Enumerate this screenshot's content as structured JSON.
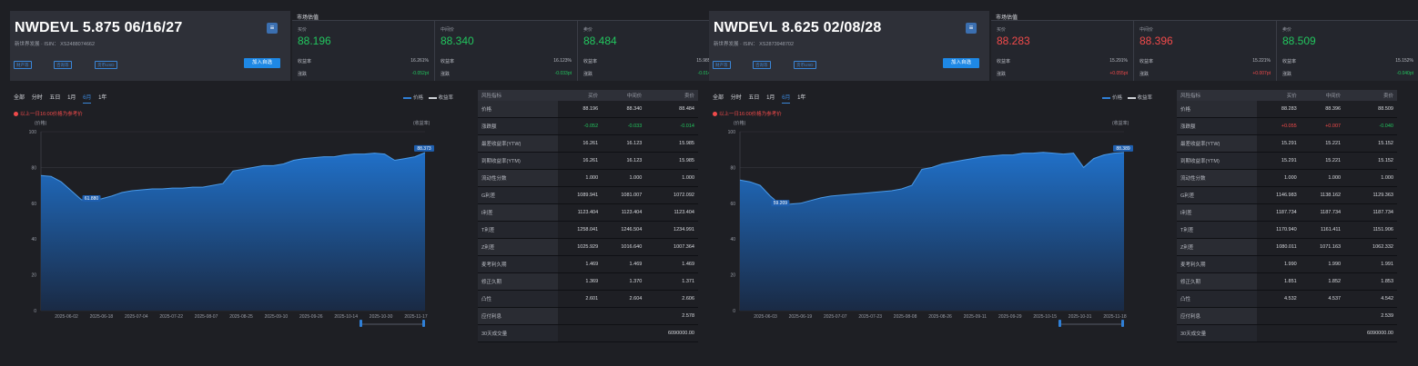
{
  "panels": [
    {
      "title": "NWDEVL 5.875 06/16/27",
      "subtitle": "新世界发展 · ISIN： XS2488074662",
      "tags": [
        "财产等",
        "咨询等",
        "货币USD"
      ],
      "add_button": "加入自选",
      "market": {
        "title": "市场估值",
        "quotes": [
          {
            "label": "买价",
            "price": "88.196",
            "yield_label": "收益率",
            "yield": "16.261%",
            "chg_label": "涨跌",
            "chg": "-0.052pt",
            "price_color": "green",
            "chg_color": "green"
          },
          {
            "label": "中间价",
            "price": "88.340",
            "yield_label": "收益率",
            "yield": "16.123%",
            "chg_label": "涨跌",
            "chg": "-0.033pt",
            "price_color": "green",
            "chg_color": "green"
          },
          {
            "label": "卖价",
            "price": "88.484",
            "yield_label": "收益率",
            "yield": "15.985%",
            "chg_label": "涨跌",
            "chg": "-0.014pt",
            "price_color": "green",
            "chg_color": "green"
          }
        ]
      },
      "chart": {
        "tabs": [
          "全部",
          "分时",
          "五日",
          "1月",
          "6月",
          "1年"
        ],
        "active_tab": "6月",
        "legend": [
          "价格",
          "收益率"
        ],
        "notice": "以上一日16:00价格为参考价",
        "ylabel_left": "(价格)",
        "ylabel_right": "(收益率)"
      },
      "risk_table": {
        "headers": [
          "风险指标",
          "买价",
          "中间价",
          "卖价"
        ],
        "rows": [
          {
            "label": "价格",
            "bid": "88.196",
            "mid": "88.340",
            "ask": "88.484"
          },
          {
            "label": "涨跌额",
            "bid": "-0.052",
            "mid": "-0.033",
            "ask": "-0.014",
            "color": "green"
          },
          {
            "label": "最差收益率(YTW)",
            "bid": "16.261",
            "mid": "16.123",
            "ask": "15.985"
          },
          {
            "label": "到期收益率(YTM)",
            "bid": "16.261",
            "mid": "16.123",
            "ask": "15.985"
          },
          {
            "label": "流动性分数",
            "bid": "1.000",
            "mid": "1.000",
            "ask": "1.000"
          },
          {
            "label": "G利差",
            "bid": "1089.941",
            "mid": "1081.007",
            "ask": "1072.092"
          },
          {
            "label": "I利差",
            "bid": "1123.404",
            "mid": "1123.404",
            "ask": "1123.404"
          },
          {
            "label": "T利差",
            "bid": "1258.041",
            "mid": "1246.504",
            "ask": "1234.991"
          },
          {
            "label": "Z利差",
            "bid": "1025.929",
            "mid": "1016.640",
            "ask": "1007.364"
          },
          {
            "label": "麦考利久期",
            "bid": "1.469",
            "mid": "1.469",
            "ask": "1.469"
          },
          {
            "label": "修正久期",
            "bid": "1.369",
            "mid": "1.370",
            "ask": "1.371"
          },
          {
            "label": "凸性",
            "bid": "2.601",
            "mid": "2.604",
            "ask": "2.606"
          },
          {
            "label": "应付利息",
            "bid": "",
            "mid": "",
            "ask": "2.578"
          },
          {
            "label": "30天成交量",
            "bid": "",
            "mid": "",
            "ask": "6090000.00"
          }
        ]
      }
    },
    {
      "title": "NWDEVL 8.625 02/08/28",
      "subtitle": "新世界发展 · ISIN： XS2873948702",
      "tags": [
        "财产等",
        "咨询等",
        "货币USD"
      ],
      "add_button": "加入自选",
      "market": {
        "title": "市场估值",
        "quotes": [
          {
            "label": "买价",
            "price": "88.283",
            "yield_label": "收益率",
            "yield": "15.291%",
            "chg_label": "涨跌",
            "chg": "+0.055pt",
            "price_color": "red",
            "chg_color": "red"
          },
          {
            "label": "中间价",
            "price": "88.396",
            "yield_label": "收益率",
            "yield": "15.221%",
            "chg_label": "涨跌",
            "chg": "+0.007pt",
            "price_color": "red",
            "chg_color": "red"
          },
          {
            "label": "卖价",
            "price": "88.509",
            "yield_label": "收益率",
            "yield": "15.152%",
            "chg_label": "涨跌",
            "chg": "-0.040pt",
            "price_color": "green",
            "chg_color": "green"
          }
        ]
      },
      "chart": {
        "tabs": [
          "全部",
          "分时",
          "五日",
          "1月",
          "6月",
          "1年"
        ],
        "active_tab": "6月",
        "legend": [
          "价格",
          "收益率"
        ],
        "notice": "以上一日16:00价格为参考价",
        "ylabel_left": "(价格)",
        "ylabel_right": "(收益率)"
      },
      "risk_table": {
        "headers": [
          "风险指标",
          "买价",
          "中间价",
          "卖价"
        ],
        "rows": [
          {
            "label": "价格",
            "bid": "88.283",
            "mid": "88.396",
            "ask": "88.509"
          },
          {
            "label": "涨跌额",
            "bid": "+0.055",
            "mid": "+0.007",
            "ask": "-0.040",
            "color": "mixed"
          },
          {
            "label": "最差收益率(YTW)",
            "bid": "15.291",
            "mid": "15.221",
            "ask": "15.152"
          },
          {
            "label": "到期收益率(YTM)",
            "bid": "15.291",
            "mid": "15.221",
            "ask": "15.152"
          },
          {
            "label": "流动性分数",
            "bid": "1.000",
            "mid": "1.000",
            "ask": "1.000"
          },
          {
            "label": "G利差",
            "bid": "1146.983",
            "mid": "1138.162",
            "ask": "1129.363"
          },
          {
            "label": "I利差",
            "bid": "1187.734",
            "mid": "1187.734",
            "ask": "1187.734"
          },
          {
            "label": "T利差",
            "bid": "1170.940",
            "mid": "1161.411",
            "ask": "1151.906"
          },
          {
            "label": "Z利差",
            "bid": "1080.011",
            "mid": "1071.163",
            "ask": "1062.332"
          },
          {
            "label": "麦考利久期",
            "bid": "1.990",
            "mid": "1.990",
            "ask": "1.991"
          },
          {
            "label": "修正久期",
            "bid": "1.851",
            "mid": "1.852",
            "ask": "1.853"
          },
          {
            "label": "凸性",
            "bid": "4.532",
            "mid": "4.537",
            "ask": "4.542"
          },
          {
            "label": "应付利息",
            "bid": "",
            "mid": "",
            "ask": "2.539"
          },
          {
            "label": "30天成交量",
            "bid": "",
            "mid": "",
            "ask": "6090000.00"
          }
        ]
      }
    }
  ],
  "chart_data": [
    {
      "type": "area",
      "title": "",
      "ylim": [
        0,
        100
      ],
      "yticks": [
        "0",
        "20",
        "40",
        "60",
        "80",
        "100"
      ],
      "xticks": [
        "2025-06-02",
        "2025-06-18",
        "2025-07-04",
        "2025-07-22",
        "2025-08-07",
        "2025-08-25",
        "2025-09-10",
        "2025-09-26",
        "2025-10-14",
        "2025-10-30",
        "2025-11-17"
      ],
      "series": [
        {
          "name": "价格",
          "values": [
            75.5,
            75,
            72,
            67,
            62,
            61.9,
            62.5,
            64,
            66,
            67,
            67.5,
            68,
            68,
            68.5,
            68.5,
            69,
            69,
            70,
            71,
            78,
            79,
            80,
            81,
            81,
            82,
            84,
            85,
            85.5,
            86,
            86,
            87,
            87.5,
            87.5,
            88,
            87.5,
            84,
            85,
            86,
            88.4
          ]
        }
      ],
      "min_label": "61.880",
      "last_label": "88.373"
    },
    {
      "type": "area",
      "title": "",
      "ylim": [
        0,
        100
      ],
      "yticks": [
        "0",
        "20",
        "40",
        "60",
        "80",
        "100"
      ],
      "xticks": [
        "2025-06-03",
        "2025-06-19",
        "2025-07-07",
        "2025-07-23",
        "2025-08-08",
        "2025-08-26",
        "2025-09-11",
        "2025-09-29",
        "2025-10-15",
        "2025-10-31",
        "2025-11-18"
      ],
      "series": [
        {
          "name": "价格",
          "values": [
            73,
            72,
            70,
            64,
            59.3,
            59.5,
            60,
            61.5,
            63,
            64,
            64.5,
            65,
            65.5,
            66,
            66.5,
            67,
            68,
            70,
            79,
            80,
            82,
            83,
            84,
            85,
            86,
            86.5,
            87,
            87,
            88,
            88,
            88.5,
            88,
            87.5,
            88,
            80,
            85,
            87,
            88,
            88.4
          ]
        }
      ],
      "min_label": "59.209",
      "last_label": "88.389"
    }
  ]
}
